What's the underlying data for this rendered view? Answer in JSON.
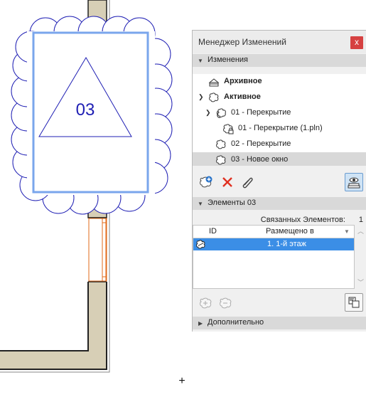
{
  "panel": {
    "title": "Менеджер Изменений",
    "close_glyph": "x"
  },
  "sections": {
    "changes": "Изменения",
    "elements": "Элементы 03",
    "additional": "Дополнительно"
  },
  "tree": {
    "items": [
      {
        "label": "Архивное",
        "icon": "archive-stack-icon",
        "bold": true
      },
      {
        "label": "Активное",
        "icon": "cloud-icon",
        "bold": true
      },
      {
        "label": "01 - Перекрытие",
        "icon": "cloud-icon",
        "bold": false
      },
      {
        "label": "01 - Перекрытие (1.pln)",
        "icon": "cloud-lock-icon",
        "bold": false
      },
      {
        "label": "02 - Перекрытие",
        "icon": "cloud-icon",
        "bold": false
      },
      {
        "label": "03 - Новое окно",
        "icon": "cloud-icon",
        "bold": false,
        "selected": true
      }
    ]
  },
  "linked": {
    "label": "Связанных Элементов:",
    "count": "1"
  },
  "table": {
    "columns": [
      "ID",
      "Размещено в"
    ],
    "rows": [
      {
        "id": "",
        "location": "1. 1-й этаж"
      }
    ]
  },
  "drawing": {
    "marker_label": "03",
    "cursor_glyph": "+"
  },
  "colors": {
    "wall_fill": "#d7cfb6",
    "selection_blue": "#7aa6ec",
    "cloud_stroke": "#1f1fb4",
    "window_orange": "#e06a1a",
    "row_selected": "#3b8ee6",
    "close_red": "#d64141"
  }
}
